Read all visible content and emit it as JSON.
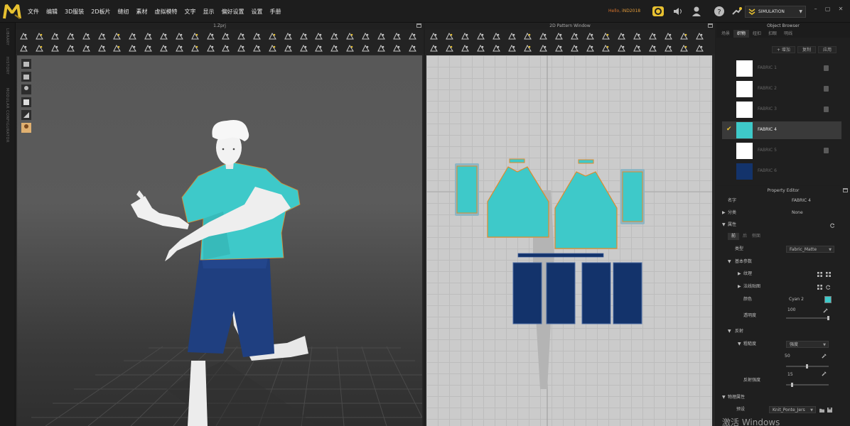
{
  "app": {
    "logo_letters": "M",
    "menus": [
      "文件",
      "编辑",
      "3D服装",
      "2D板片",
      "缝纫",
      "素材",
      "虚拟模特",
      "文字",
      "显示",
      "偏好设置",
      "设置",
      "手册"
    ],
    "user_label": "Hello,",
    "user_name": "iND2018",
    "simulation_label": "SIMULATION",
    "colors": {
      "accent": "#e8c130",
      "cyan": "#3ec9c9",
      "navy": "#13336b",
      "orange_outline": "#e08a2a"
    }
  },
  "sidebar": {
    "labels": [
      "LIBRARY",
      "HISTORY",
      "MODULAR CONFIGURATOR"
    ]
  },
  "view3d": {
    "title": "1.Zprj"
  },
  "view2d": {
    "title": "2D Pattern Window"
  },
  "object_browser": {
    "title": "Object Browser",
    "tabs": [
      "场景",
      "织物",
      "纽扣",
      "扣眼",
      "明线"
    ],
    "active_tab": "织物",
    "add_label": "+ 增加",
    "copy_label": "复制",
    "third_btn": "应用",
    "fabrics": [
      {
        "name": "FABRIC 1",
        "color": "#ffffff",
        "selected": false
      },
      {
        "name": "FABRIC 2",
        "color": "#ffffff",
        "selected": false
      },
      {
        "name": "FABRIC 3",
        "color": "#ffffff",
        "selected": false
      },
      {
        "name": "FABRIC 4",
        "color": "#3ec9c9",
        "selected": true
      },
      {
        "name": "FABRIC 5",
        "color": "#ffffff",
        "selected": false
      },
      {
        "name": "FABRIC 6",
        "color": "#13336b",
        "selected": false
      }
    ]
  },
  "property_editor": {
    "title": "Property Editor",
    "name_label": "名字",
    "name_value": "FABRIC 4",
    "category_label": "分类",
    "category_value": "None",
    "attribute_label": "属性",
    "subtabs": [
      "前",
      "后",
      "侧面"
    ],
    "type_label": "类型",
    "type_value": "Fabric_Matte",
    "basic_label": "基本参数",
    "texture_label": "纹理",
    "normal_label": "法线贴图",
    "color_label": "颜色",
    "color_value": "Cyan 2",
    "opacity_label": "透明度",
    "opacity_value": "100",
    "opacity_fraction": 1.0,
    "reflect_label": "反射",
    "roughness_label": "粗糙度",
    "roughness_type": "强度",
    "roughness_value": "50",
    "roughness_fraction": 0.5,
    "reflect_strength_label": "反射强度",
    "reflect_strength_value": "15",
    "reflect_strength_fraction": 0.15,
    "physical_label": "物理属性",
    "preset_label": "预设",
    "preset_value": "Knit_Ponte_Jers"
  },
  "watermark": "激活 Windows"
}
